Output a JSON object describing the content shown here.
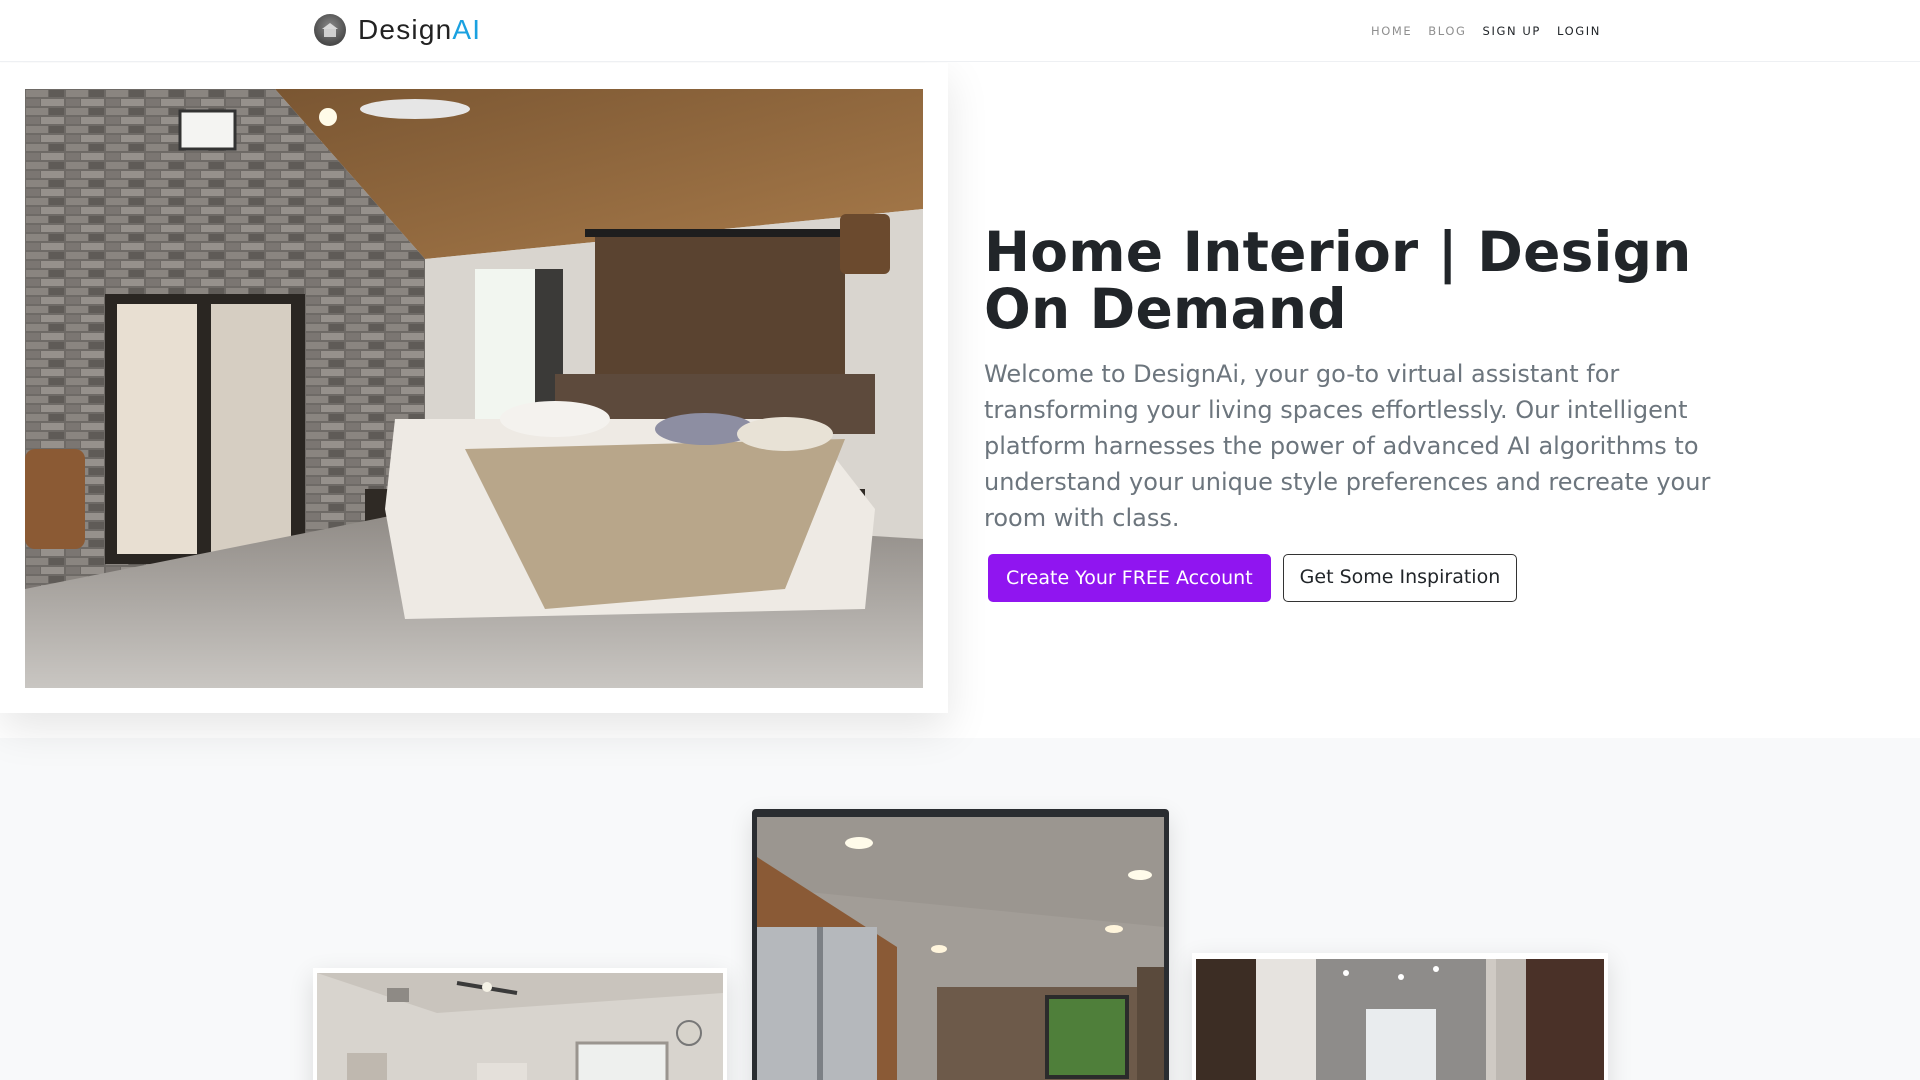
{
  "brand": {
    "name_main": "Design",
    "name_accent": "AI",
    "logo_icon": "house-logo-icon",
    "accent_color": "#1aa1e0"
  },
  "nav": {
    "items": [
      {
        "label": "HOME"
      },
      {
        "label": "BLOG"
      },
      {
        "label": "SIGN UP"
      },
      {
        "label": "LOGIN"
      }
    ]
  },
  "hero": {
    "title": "Home Interior | Design On Demand",
    "lead": "Welcome to DesignAi, your go-to virtual assistant for transforming your living spaces effortlessly. Our intelligent platform harnesses the power of advanced AI algorithms to understand your unique style preferences and recreate your room with class.",
    "primary_button": "Create Your FREE Account",
    "secondary_button": "Get Some Inspiration",
    "primary_color": "#9015f0",
    "image": "bedroom-render-image"
  },
  "gallery": {
    "images": [
      "bedroom-living-image",
      "kitchen-image",
      "bathroom-image"
    ]
  }
}
